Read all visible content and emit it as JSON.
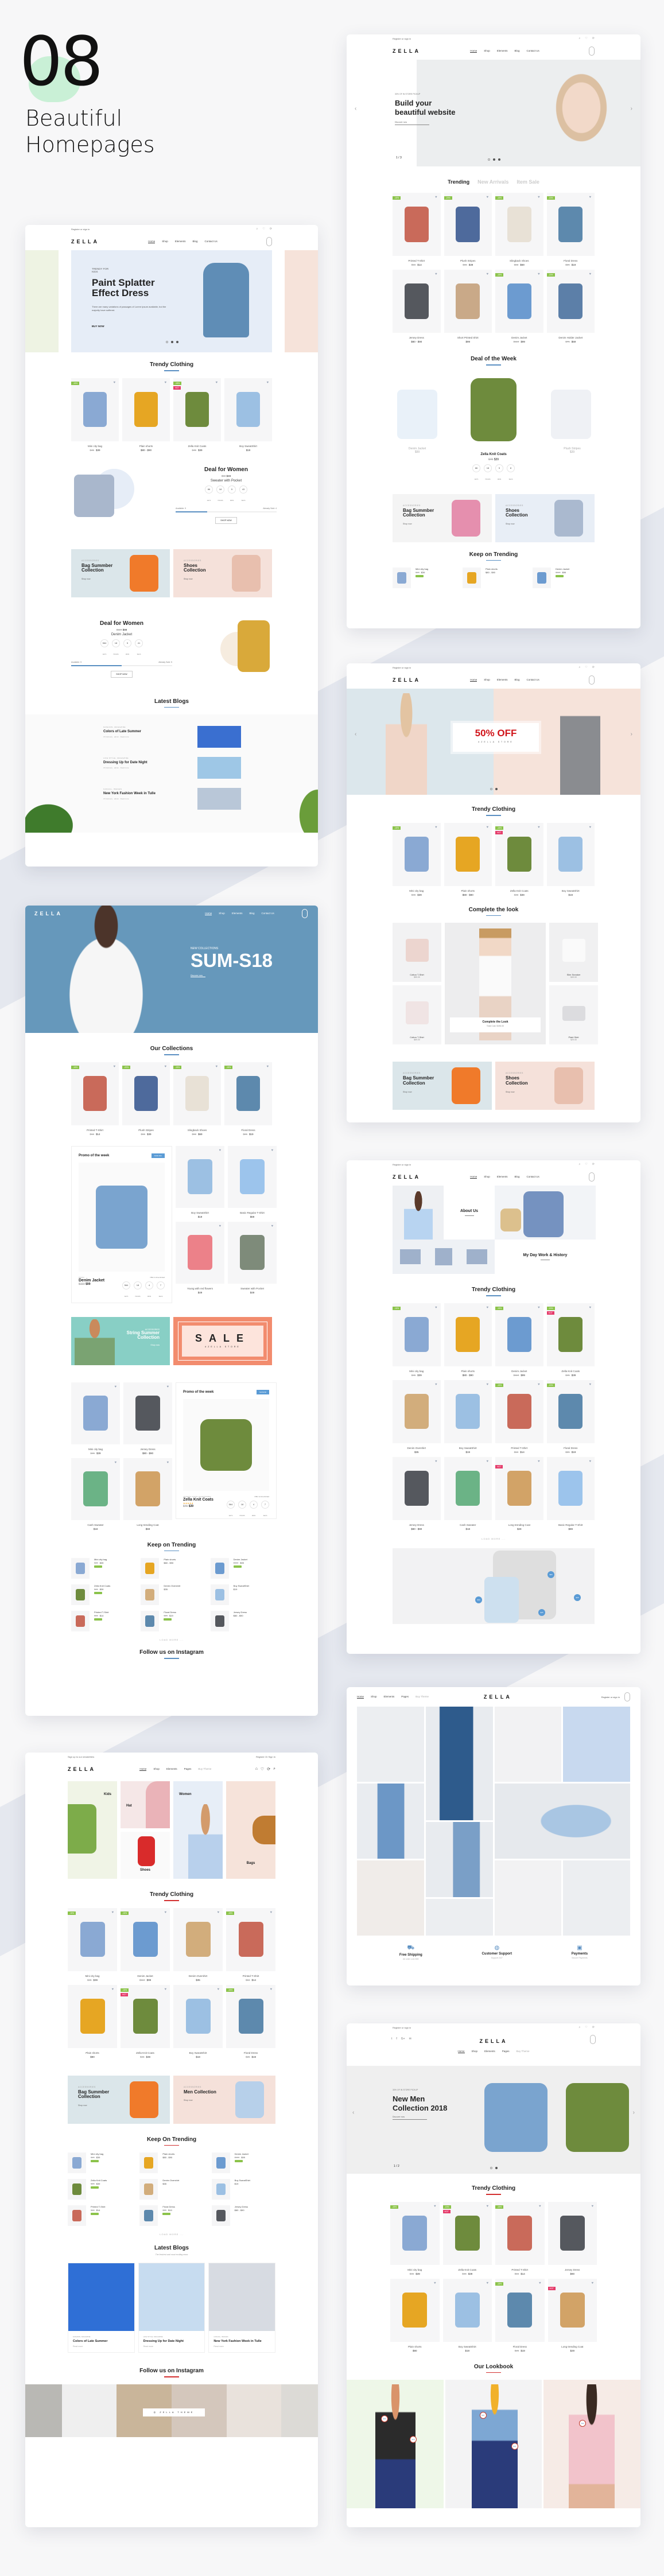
{
  "showcase": {
    "number": "08",
    "title_line1": "Beautiful",
    "title_line2": "Homepages"
  },
  "common": {
    "brand": "ZELLA",
    "register": "Register or sign in",
    "nav": [
      "Home",
      "Shop",
      "Elements",
      "Blog",
      "Contact Us"
    ],
    "nav_alt": [
      "Home",
      "Shop",
      "Elements",
      "Pages",
      "Buy Theme"
    ],
    "newsletter": "Sign up to our newsletters",
    "register_alt": "Register Or Sign In",
    "load_more": "LOAD MORE ...",
    "shop_now": "Shop now",
    "accessories": "ACCESSORIES",
    "countdown_labels": [
      "DAYS",
      "HOURS",
      "MINS",
      "SECS"
    ],
    "colors": {
      "accent_blue": "#5a8fc2",
      "accent_red": "#d32f2f",
      "badge_green": "#8bc34a",
      "badge_hot": "#e53b6a"
    }
  },
  "home1": {
    "hero_kicker": "TRENDY FOR KIDS",
    "hero_title": "Paint Splatter Effect Dress",
    "hero_text": "There are many variations of passages of Lorem Ipsum available, but the majority have suffered.",
    "hero_cta": "BUY NOW",
    "section_title": "Trendy Clothing",
    "products": [
      {
        "name": "Mini city bag",
        "old": "$45",
        "price": "$39",
        "badge": "-15%",
        "color": "#8aa9d3"
      },
      {
        "name": "Plain shorts",
        "old": "",
        "price": "$80 - $90",
        "badge": "",
        "color": "#e6a623"
      },
      {
        "name": "Zella Knit Coats",
        "old": "$45",
        "price": "$39",
        "badge": "-15%",
        "hot": "HOT",
        "color": "#6e8b3d"
      },
      {
        "name": "Boy SweatShirt",
        "old": "",
        "price": "$19",
        "badge": "",
        "color": "#9cc0e3"
      }
    ],
    "deal1": {
      "title": "Deal for Women",
      "old": "$59",
      "price": "$49",
      "product": "Sweater with Pocket",
      "countdown": [
        "86",
        "18",
        "5",
        "43"
      ],
      "available_label": "Available: 9",
      "sold_label": "Already Sold: 4",
      "progress": 0.31,
      "cta": "SHOP NOW"
    },
    "banners": [
      {
        "title": "Bag Summber Collection",
        "bg": "#dbe6ea",
        "pic": "#f07a2a"
      },
      {
        "title": "Shoes Collection",
        "bg": "#f5e1da",
        "pic": "#e8bfae"
      }
    ],
    "deal2": {
      "title": "Deal for Women",
      "old": "$110",
      "price": "$99",
      "product": "Denim Jacket",
      "countdown": [
        "564",
        "18",
        "5",
        "41"
      ],
      "available_label": "Available: 5",
      "sold_label": "Already Sold: 5",
      "progress": 0.5,
      "cta": "SHOP NOW"
    },
    "blogs_title": "Latest Blogs",
    "blogs": [
      {
        "cat": "FASHION, MAGAZINE",
        "title": "Colors of Late Summer",
        "meta": "15 February · admin · Read more"
      },
      {
        "cat": "LIFE STYLE, MAGAZINE",
        "title": "Dressing Up for Date Night",
        "meta": "15 February · admin · Read more"
      },
      {
        "cat": "CASUAL, IMAGES",
        "title": "New York Fashion Week in Tulle",
        "meta": "15 February · admin · Read more"
      }
    ]
  },
  "home2": {
    "hero_kicker": "30% OF IN STORE PICKUP",
    "hero_title_1": "Build your",
    "hero_title_2": "beautiful website",
    "hero_cta": "Discover now",
    "slide_counter": "1 / 3",
    "tabs": [
      "Trending",
      "New Arrivals",
      "Item Sale"
    ],
    "products": [
      {
        "name": "Printed T-Shirt",
        "old": "$16",
        "price": "$14",
        "badge": "-15%",
        "color": "#c96a5a"
      },
      {
        "name": "Plush Stripes",
        "old": "$65",
        "price": "$39",
        "badge": "-20%",
        "color": "#4e6a9c"
      },
      {
        "name": "Slingback Shoes",
        "old": "$83",
        "price": "$69",
        "badge": "-15%",
        "color": "#e8e1d6"
      },
      {
        "name": "Floral Dress",
        "old": "$25",
        "price": "$19",
        "badge": "-15%",
        "color": "#5d89ad"
      },
      {
        "name": "Jersey Dress",
        "old": "",
        "price": "$80 - $90",
        "badge": "",
        "color": "#55585e"
      },
      {
        "name": "Short Printed Shirt",
        "old": "",
        "price": "$99",
        "badge": "",
        "color": "#c9a988"
      },
      {
        "name": "Denim Jacket",
        "old": "$110",
        "price": "$99",
        "badge": "-15%",
        "color": "#6c9bd0"
      },
      {
        "name": "Denim Holder Jacket",
        "old": "$75",
        "price": "$69",
        "badge": "-15%",
        "color": "#5c7fa8"
      }
    ],
    "deal_title": "Deal of the Week",
    "deal_side": [
      {
        "name": "Denim Jacket",
        "old": "$110",
        "price": "$99"
      },
      {
        "name": "Plush Stripes",
        "old": "$45",
        "price": "$39"
      }
    ],
    "deal_main": {
      "name": "Zella Knit Coats",
      "old": "$45",
      "price": "$39",
      "countdown": [
        "86",
        "18",
        "5",
        "8"
      ]
    },
    "banners": [
      {
        "title": "Bag Summber Collection",
        "bg": "#f4f4f4",
        "pic": "#e58fae"
      },
      {
        "title": "Shoes Collection",
        "bg": "#e8eef6",
        "pic": "#aab9cf"
      }
    ],
    "kt_title": "Keep on Trending",
    "kt_items": [
      {
        "name": "Mini city bag",
        "price": "$39",
        "old": "$45",
        "color": "#8aa9d3"
      },
      {
        "name": "Plain shorts",
        "price": "$80 - $90",
        "old": "",
        "color": "#e6a623"
      },
      {
        "name": "Denim Jacket",
        "price": "$99",
        "old": "$110",
        "color": "#6c9bd0"
      }
    ]
  },
  "home3": {
    "hero_big": "50% OFF",
    "hero_small": "#ZELLA STORE",
    "section_title": "Trendy Clothing",
    "products": [
      {
        "name": "Mini city bag",
        "old": "$45",
        "price": "$39",
        "badge": "-15%",
        "color": "#8aa9d3"
      },
      {
        "name": "Plain shorts",
        "old": "",
        "price": "$80 - $90",
        "badge": "",
        "color": "#e6a623"
      },
      {
        "name": "Zella Knit Coats",
        "old": "$45",
        "price": "$39",
        "badge": "-15%",
        "hot": "HOT",
        "color": "#6e8b3d"
      },
      {
        "name": "Boy SweatShirt",
        "old": "",
        "price": "$19",
        "badge": "",
        "color": "#9cc0e3"
      }
    ],
    "look_title": "Complete the look",
    "look_items": [
      {
        "name": "Cotton T-Shirt",
        "price": "$59.00"
      },
      {
        "name": "Slim Sneaker",
        "price": "$49.00"
      },
      {
        "name": "Cotton T-Shirt",
        "price": "$69.00"
      },
      {
        "name": "Plaid Skirt",
        "price": "$29.00"
      }
    ],
    "look_center_title": "Complete the Look",
    "look_center_total": "Total Cost: $196.00",
    "banners": [
      {
        "title": "Bag Summber Collection",
        "bg": "#dbe6ea",
        "pic": "#f07a2a"
      },
      {
        "title": "Shoes Collection",
        "bg": "#f5e1da",
        "pic": "#e8bfae"
      }
    ]
  },
  "home4": {
    "hero_kicker": "NEW COLLECTIONS",
    "hero_title": "SUM-S18",
    "hero_cta": "Discover now",
    "section_title": "Our Collections",
    "products": [
      {
        "name": "Printed T-Shirt",
        "old": "$16",
        "price": "$14",
        "badge": "-15%",
        "color": "#c96a5a"
      },
      {
        "name": "Plush Stripes",
        "old": "$65",
        "price": "$39",
        "badge": "-20%",
        "color": "#4e6a9c"
      },
      {
        "name": "Slingback Shoes",
        "old": "$83",
        "price": "$69",
        "badge": "-15%",
        "color": "#e8e1d6"
      },
      {
        "name": "Floral Dress",
        "old": "$25",
        "price": "$19",
        "badge": "-15%",
        "color": "#5d89ad"
      }
    ],
    "promo1": {
      "title": "Promo of the week",
      "save": "SAVE $11",
      "kicker": "DENIM",
      "name": "Denim Jacket",
      "old": "$110",
      "price": "$99",
      "offer": "Offer is time limited",
      "countdown": [
        "564",
        "18",
        "4",
        "7"
      ]
    },
    "side_products": [
      {
        "name": "Boy SweatShirt",
        "price": "$19",
        "color": "#9cc0e3"
      },
      {
        "name": "Basic Regular T-Shirt",
        "price": "$69",
        "color": "#9cc4ec"
      },
      {
        "name": "Young with red flowers",
        "price": "$49",
        "color": "#ec8189"
      },
      {
        "name": "Sweater with Pocket",
        "price": "$49",
        "color": "#7e8b7a"
      }
    ],
    "banner_left": {
      "kicker": "ACCESSORIES",
      "title": "String Summer Collection",
      "cta": "Shop now"
    },
    "banner_right": {
      "title": "SALE",
      "sub": "#ZELLA STORE"
    },
    "grid_products": [
      {
        "name": "Mini city bag",
        "price": "$39",
        "old": "$45",
        "color": "#8aa9d3"
      },
      {
        "name": "Jersey Dress",
        "price": "$80 - $90",
        "old": "",
        "color": "#55585e"
      },
      {
        "name": "Cash Sweater",
        "price": "$18",
        "old": "",
        "color": "#6bb386"
      },
      {
        "name": "Long trending Coat",
        "price": "$69",
        "old": "",
        "color": "#d2a367"
      }
    ],
    "promo2": {
      "title": "Promo of the week",
      "save": "SAVE $6",
      "kicker": "JACKETS, COATS, ACCESSORIES",
      "name": "Zella Knit Coats",
      "old": "$45",
      "price": "$39",
      "offer": "Offer is time limited",
      "countdown": [
        "564",
        "18",
        "4",
        "7"
      ]
    },
    "kt_title": "Keep on Trending",
    "kt_items": [
      {
        "name": "Mini city bag",
        "price": "$39",
        "old": "$45",
        "color": "#8aa9d3"
      },
      {
        "name": "Plain shorts",
        "price": "$80 - $90",
        "old": "",
        "color": "#e6a623"
      },
      {
        "name": "Denim Jacket",
        "price": "$99",
        "old": "$110",
        "color": "#6c9bd0"
      },
      {
        "name": "Zella Knit Coats",
        "price": "$39",
        "old": "$45",
        "color": "#6e8b3d"
      },
      {
        "name": "Denim Overshirt",
        "price": "$35",
        "old": "",
        "color": "#d2ad7c"
      },
      {
        "name": "Boy SweatShirt",
        "price": "$19",
        "old": "",
        "color": "#9cc0e3"
      },
      {
        "name": "Printed T-Shirt",
        "price": "$14",
        "old": "$16",
        "color": "#c96a5a"
      },
      {
        "name": "Floral Dress",
        "price": "$19",
        "old": "$25",
        "color": "#5d89ad"
      },
      {
        "name": "Jersey Dress",
        "price": "$80 - $90",
        "old": "",
        "color": "#55585e"
      }
    ],
    "insta_title": "Follow us on Instagram"
  },
  "home5": {
    "about_title": "About Us",
    "history_title": "My Day Work & History",
    "section_title": "Trendy Clothing",
    "products": [
      {
        "name": "Mini city bag",
        "old": "$45",
        "price": "$39",
        "badge": "-15%",
        "color": "#8aa9d3"
      },
      {
        "name": "Plain shorts",
        "old": "",
        "price": "$80 - $90",
        "badge": "",
        "color": "#e6a623"
      },
      {
        "name": "Denim Jacket",
        "old": "$110",
        "price": "$99",
        "badge": "-15%",
        "color": "#6c9bd0"
      },
      {
        "name": "Zella Knit Coats",
        "old": "$45",
        "price": "$39",
        "badge": "-15%",
        "hot": "HOT",
        "color": "#6e8b3d"
      },
      {
        "name": "Denim Overshirt",
        "old": "",
        "price": "$35",
        "badge": "",
        "color": "#d2ad7c"
      },
      {
        "name": "Boy SweatShirt",
        "old": "",
        "price": "$19",
        "badge": "",
        "color": "#9cc0e3"
      },
      {
        "name": "Printed T-Shirt",
        "old": "$16",
        "price": "$14",
        "badge": "-15%",
        "color": "#c96a5a"
      },
      {
        "name": "Floral Dress",
        "old": "$25",
        "price": "$19",
        "badge": "-15%",
        "color": "#5d89ad"
      },
      {
        "name": "Jersey Dress",
        "old": "",
        "price": "$80 - $90",
        "badge": "",
        "color": "#55585e"
      },
      {
        "name": "Cash Sweater",
        "old": "",
        "price": "$18",
        "badge": "",
        "color": "#6bb386"
      },
      {
        "name": "Long trending Coat",
        "old": "",
        "price": "$29",
        "badge": "",
        "hot": "HOT",
        "color": "#d2a367"
      },
      {
        "name": "Basic Regular T-Shirt",
        "old": "",
        "price": "$89",
        "badge": "",
        "color": "#9cc4ec"
      }
    ],
    "hotspots": [
      "$80",
      "$60",
      "$45",
      "$25"
    ]
  },
  "home6": {
    "register": "Register or sign in",
    "features": [
      {
        "title": "Free Shipping",
        "sub": "All order over $50"
      },
      {
        "title": "Customer Support",
        "sub": "Support 24/7"
      },
      {
        "title": "Payments",
        "sub": "Secure Payments"
      }
    ]
  },
  "home7": {
    "categories": [
      "Kids",
      "Hat",
      "Shoes",
      "Women",
      "Bags"
    ],
    "section_title": "Trendy Clothing",
    "products": [
      {
        "name": "Mini city bag",
        "old": "$45",
        "price": "$39",
        "badge": "-15%",
        "color": "#8aa9d3"
      },
      {
        "name": "Denim Jacket",
        "old": "$110",
        "price": "$99",
        "badge": "-15%",
        "color": "#6c9bd0"
      },
      {
        "name": "Denim Overshirt",
        "old": "",
        "price": "$35",
        "badge": "",
        "color": "#d2ad7c"
      },
      {
        "name": "Printed T-Shirt",
        "old": "$16",
        "price": "$14",
        "badge": "-15%",
        "color": "#c96a5a"
      },
      {
        "name": "Plain shorts",
        "old": "",
        "price": "$90",
        "badge": "",
        "color": "#e6a623"
      },
      {
        "name": "Zella Knit Coats",
        "old": "$45",
        "price": "$39",
        "badge": "-15%",
        "hot": "HOT",
        "color": "#6e8b3d"
      },
      {
        "name": "Boy SweatShirt",
        "old": "",
        "price": "$19",
        "badge": "",
        "color": "#9cc0e3"
      },
      {
        "name": "Floral Dress",
        "old": "$25",
        "price": "$19",
        "badge": "-15%",
        "color": "#5d89ad"
      }
    ],
    "banners": [
      {
        "title": "Bag Summber Collection",
        "bg": "#dbe6ea",
        "pic": "#f07a2a"
      },
      {
        "title": "Men Collection",
        "bg": "#f5e1da",
        "pic": "#b7d0ea"
      }
    ],
    "kt_title": "Keep On Trending",
    "kt_items": [
      {
        "name": "Mini city bag",
        "price": "$39",
        "old": "$45",
        "color": "#8aa9d3"
      },
      {
        "name": "Plain shorts",
        "price": "$80 - $90",
        "old": "",
        "color": "#e6a623"
      },
      {
        "name": "Denim Jacket",
        "price": "$99",
        "old": "$110",
        "color": "#6c9bd0"
      },
      {
        "name": "Zella Knit Coats",
        "price": "$39",
        "old": "$45",
        "color": "#6e8b3d"
      },
      {
        "name": "Denim Overshirt",
        "price": "$35",
        "old": "",
        "color": "#d2ad7c"
      },
      {
        "name": "Boy SweatShirt",
        "price": "$19",
        "old": "",
        "color": "#9cc0e3"
      },
      {
        "name": "Printed T-Shirt",
        "price": "$14",
        "old": "$16",
        "color": "#c96a5a"
      },
      {
        "name": "Floral Dress",
        "price": "$19",
        "old": "$25",
        "color": "#5d89ad"
      },
      {
        "name": "Jersey Dress",
        "price": "$80 - $90",
        "old": "",
        "color": "#55585e"
      }
    ],
    "blogs_title": "Latest Blogs",
    "blogs_sub": "The freshest and most exciting news",
    "blogs": [
      {
        "cat": "FASHION, MAGAZINE",
        "title": "Colors of Late Summer",
        "cta": "Read more"
      },
      {
        "cat": "LIFE STYLE, MAGAZINE",
        "title": "Dressing Up for Date Night",
        "cta": "Read more"
      },
      {
        "cat": "CASUAL, IMAGES",
        "title": "New York Fashion Week in Tulle",
        "cta": "Read more"
      }
    ],
    "insta_title": "Follow us on Instagram",
    "insta_label": "ZELLA THEME"
  },
  "home8": {
    "hero_kicker": "30% OF IN STORE PICKUP",
    "hero_title_1": "New Men",
    "hero_title_2": "Collection 2018",
    "hero_cta": "Discover now",
    "slide_counter": "1 / 2",
    "section_title": "Trendy Clothing",
    "products": [
      {
        "name": "Mini city bag",
        "old": "$45",
        "price": "$39",
        "badge": "-15%",
        "color": "#8aa9d3"
      },
      {
        "name": "Zella Knit Coats",
        "old": "$45",
        "price": "$39",
        "badge": "-15%",
        "hot": "HOT",
        "color": "#6e8b3d"
      },
      {
        "name": "Printed T-Shirt",
        "old": "$16",
        "price": "$14",
        "badge": "-15%",
        "color": "#c96a5a"
      },
      {
        "name": "Jersey Dress",
        "old": "",
        "price": "$90",
        "badge": "",
        "color": "#55585e"
      },
      {
        "name": "Plain shorts",
        "old": "",
        "price": "$90",
        "badge": "",
        "color": "#e6a623"
      },
      {
        "name": "Boy SweatShirt",
        "old": "",
        "price": "$19",
        "badge": "",
        "color": "#9cc0e3"
      },
      {
        "name": "Floral Dress",
        "old": "$25",
        "price": "$19",
        "badge": "-15%",
        "color": "#5d89ad"
      },
      {
        "name": "Long trending Coat",
        "old": "",
        "price": "$29",
        "badge": "",
        "hot": "HOT",
        "color": "#d2a367"
      }
    ],
    "lookbook_title": "Our Lookbook",
    "lookbook_bgs": [
      "#eef7e8",
      "#f3f3f4",
      "#f6ebe6"
    ],
    "lookbook_hotspots": [
      "$69",
      "$29",
      "$45",
      "$29",
      "$40"
    ]
  }
}
